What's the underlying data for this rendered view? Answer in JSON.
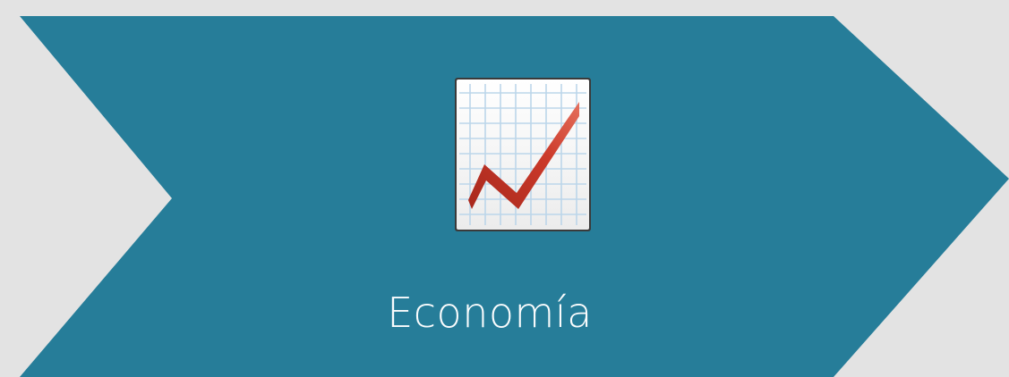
{
  "step": {
    "label": "Economía",
    "icon": "chart-increasing-icon"
  },
  "colors": {
    "background": "#e3e3e3",
    "chevron": "#267d99",
    "label": "#ffffff",
    "chart_line": "#c0392b",
    "chart_grid": "#b9d3e6"
  }
}
